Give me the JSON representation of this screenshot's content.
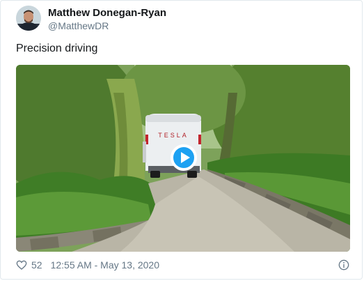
{
  "author": {
    "name": "Matthew Donegan-Ryan",
    "handle": "@MatthewDR"
  },
  "tweet": {
    "text": "Precision driving"
  },
  "media": {
    "van_logo": "TESLA",
    "play_icon": "play-icon"
  },
  "footer": {
    "likes": "52",
    "timestamp": "12:55 AM - May 13, 2020",
    "like_icon": "heart-icon",
    "info_icon": "info-icon"
  },
  "colors": {
    "accent": "#1da1f2",
    "secondary_text": "#657786",
    "border": "#e1e8ed"
  }
}
